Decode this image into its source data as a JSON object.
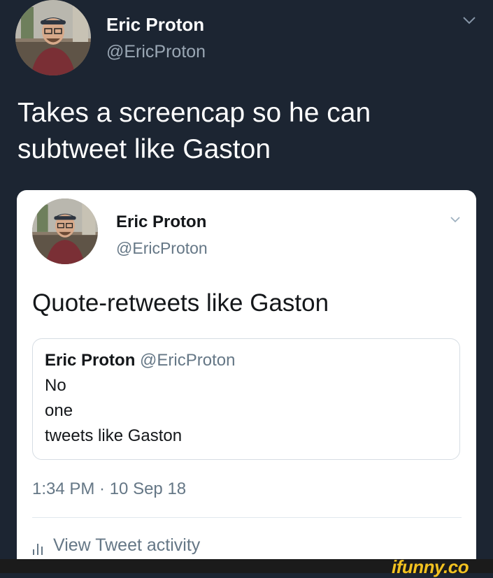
{
  "outer_tweet": {
    "author_name": "Eric Proton",
    "author_handle": "@EricProton",
    "text": "Takes a screencap so he can subtweet like Gaston"
  },
  "quoted_card": {
    "author_name": "Eric Proton",
    "author_handle": "@EricProton",
    "text": "Quote-retweets like Gaston",
    "embedded_quote": {
      "author_name": "Eric Proton",
      "author_handle": "@EricProton",
      "lines": [
        "No",
        "one",
        "tweets like Gaston"
      ]
    },
    "timestamp": "1:34 PM · 10 Sep 18",
    "activity_label": "View Tweet activity"
  },
  "watermark": "ifunny.co",
  "icons": {
    "menu": "chevron-down-icon",
    "activity": "bar-chart-icon",
    "avatar": "avatar"
  },
  "colors": {
    "background": "#1c2532",
    "card": "#ffffff",
    "secondary_text": "#657786",
    "watermark": "#f3c220"
  }
}
